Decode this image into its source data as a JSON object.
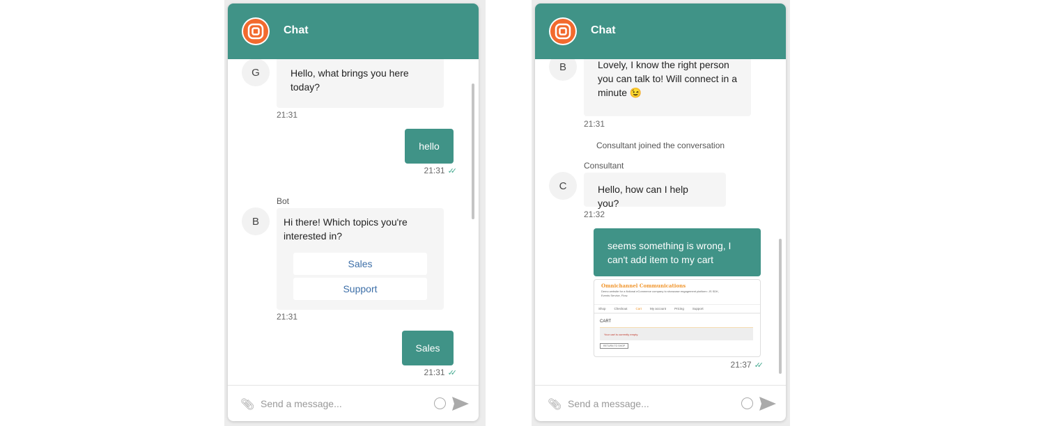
{
  "colors": {
    "brand": "#409387",
    "logo": "#f26a2e",
    "link": "#3d6fa8"
  },
  "left": {
    "header": {
      "title": "Chat",
      "logo_icon": "concentric-square-logo"
    },
    "messages": [
      {
        "avatar": "G",
        "text": "Hello, what brings you here today?",
        "time": "21:31"
      },
      {
        "from": "user",
        "text": "hello",
        "time": "21:31",
        "status": "read"
      },
      {
        "sender": "Bot",
        "avatar": "B",
        "text": "Hi there! Which topics you're interested in?",
        "buttons": [
          "Sales",
          "Support"
        ],
        "time": "21:31"
      },
      {
        "from": "user",
        "text": "Sales",
        "time": "21:31",
        "status": "read"
      }
    ],
    "input": {
      "placeholder": "Send a message..."
    }
  },
  "right": {
    "header": {
      "title": "Chat",
      "logo_icon": "concentric-square-logo"
    },
    "messages": [
      {
        "avatar": "B",
        "text": "Lovely, I know the right person you can talk to! Will connect in a minute 😉",
        "time": "21:31"
      },
      {
        "system": "Consultant joined the conversation"
      },
      {
        "sender": "Consultant",
        "avatar": "C",
        "text": "Hello, how can I help you?",
        "time": "21:32"
      },
      {
        "from": "user",
        "text": "seems something is wrong, I can't add item to my cart",
        "time": "21:37",
        "status": "read",
        "attachment": {
          "site_title": "Omnichannel Communications",
          "site_desc": "Demo website for a fictional eCommerce company to showcase engagement platform: JS SDK, Events Service, Flow.",
          "nav": [
            "Shop",
            "Checkout",
            "Cart",
            "My account",
            "Pricing",
            "Support"
          ],
          "heading": "CART",
          "notice": "Your cart is currently empty.",
          "button": "RETURN TO SHOP"
        }
      }
    ],
    "input": {
      "placeholder": "Send a message..."
    }
  }
}
